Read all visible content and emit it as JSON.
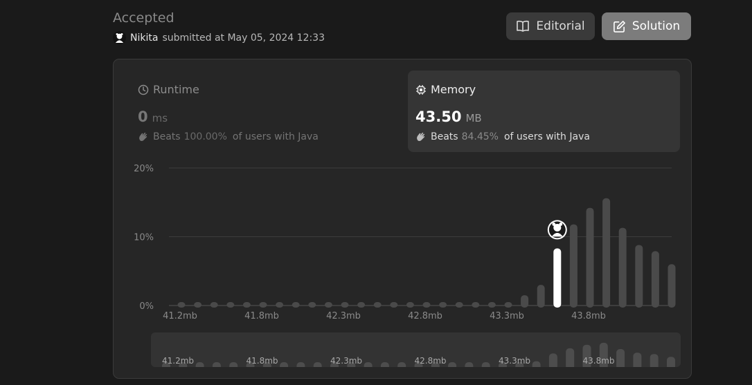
{
  "submission": {
    "status": "Accepted",
    "username": "Nikita",
    "submitted_text": "submitted at May 05, 2024 12:33"
  },
  "buttons": {
    "editorial": "Editorial",
    "solution": "Solution"
  },
  "runtime": {
    "label": "Runtime",
    "value": "0",
    "unit": "ms",
    "beats_label": "Beats",
    "beats_pct": "100.00%",
    "beats_suffix": "of users with Java",
    "icon": "clock-icon"
  },
  "memory": {
    "label": "Memory",
    "value": "43.50",
    "unit": "MB",
    "beats_label": "Beats",
    "beats_pct": "84.45%",
    "beats_suffix": "of users with Java",
    "icon": "chip-icon"
  },
  "colors": {
    "background": "#1a1a1a",
    "panel": "#262626",
    "bar": "#4a4a4a",
    "bar_highlight": "#ffffff",
    "grid": "#3d3d3d"
  },
  "chart_data": {
    "type": "bar",
    "ylabel": "",
    "xlabel": "",
    "yticks": [
      "0%",
      "10%",
      "20%"
    ],
    "ylim": [
      0,
      20
    ],
    "xticks": [
      "41.2mb",
      "41.8mb",
      "42.3mb",
      "42.8mb",
      "43.3mb",
      "43.8mb"
    ],
    "highlight_index": 23,
    "series": [
      {
        "values": [
          0.5,
          0.5,
          0.5,
          0.5,
          0.5,
          0.5,
          0.5,
          0.5,
          0.5,
          0.5,
          0.5,
          0.5,
          0.5,
          0.5,
          0.5,
          0.5,
          0.5,
          0.5,
          0.5,
          0.5,
          0.5,
          1.5,
          3.0,
          8.3,
          11.8,
          14.2,
          15.6,
          11.3,
          8.8,
          7.9,
          6.0
        ]
      }
    ],
    "overview_xticks": [
      "41.2mb",
      "41.8mb",
      "42.3mb",
      "42.8mb",
      "43.3mb",
      "43.8mb"
    ]
  }
}
